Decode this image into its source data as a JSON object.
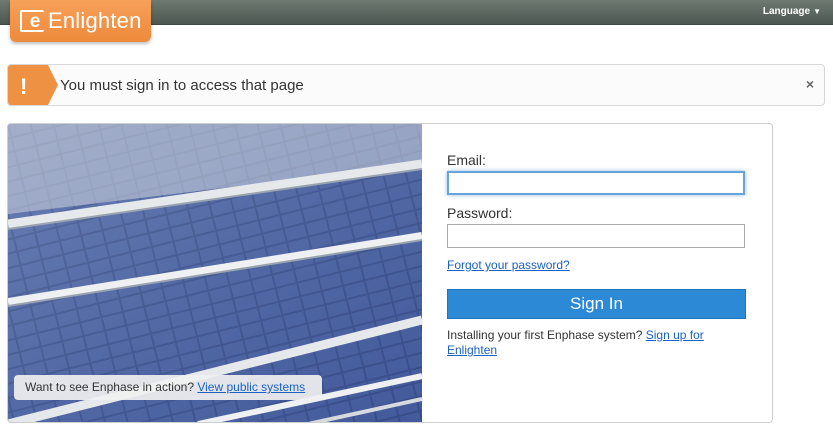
{
  "header": {
    "logo_mark": "e",
    "logo_text": "Enlighten",
    "language_label": "Language",
    "language_caret": "▼"
  },
  "alert": {
    "icon": "!",
    "message": "You must sign in to access that page",
    "close": "×",
    "color": "#ef9142"
  },
  "hero": {
    "cta_text": "Want to see Enphase in action? ",
    "cta_link": "View public systems"
  },
  "login": {
    "email_label": "Email:",
    "email_value": "",
    "password_label": "Password:",
    "password_value": "",
    "forgot_link": "Forgot your password?",
    "submit_label": "Sign In",
    "signup_text": "Installing your first Enphase system? ",
    "signup_link": "Sign up for Enlighten",
    "button_color": "#2b89d6"
  }
}
